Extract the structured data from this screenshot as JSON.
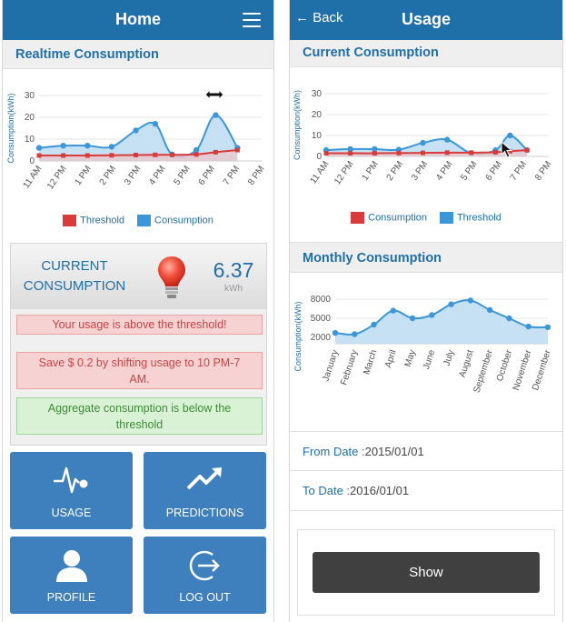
{
  "home": {
    "title": "Home",
    "menu_icon": "hamburger-menu-icon",
    "realtime_header": "Realtime Consumption",
    "chart_legend": {
      "threshold": "Threshold",
      "consumption": "Consumption"
    },
    "current": {
      "label_line1": "CURRENT",
      "label_line2": "CONSUMPTION",
      "value": "6.37",
      "unit": "kWh",
      "bulb_icon": "light-bulb-icon"
    },
    "alerts": {
      "above_threshold": "Your usage is above the threshold!",
      "savings_line1": "Save $ 0.2 by shifting usage to 10 PM-7",
      "savings_line2": "AM.",
      "aggregate_line1": "Aggregate consumption is below the",
      "aggregate_line2": "threshold"
    },
    "tiles": [
      {
        "label": "USAGE",
        "icon": "pulse-icon"
      },
      {
        "label": "PREDICTIONS",
        "icon": "trending-up-icon"
      },
      {
        "label": "PROFILE",
        "icon": "user-icon"
      },
      {
        "label": "LOG OUT",
        "icon": "logout-icon"
      }
    ]
  },
  "usage": {
    "title": "Usage",
    "back_label": "Back",
    "current_header": "Current Consumption",
    "current_legend": {
      "first": "Consumption",
      "second": "Threshold"
    },
    "monthly_header": "Monthly Consumption",
    "from_label": "From Date :",
    "from_value": "2015/01/01",
    "to_label": "To Date :",
    "to_value": "2016/01/01",
    "show_label": "Show"
  },
  "colors": {
    "header_blue": "#1f6fa8",
    "consumption_blue": "#3b97d8",
    "area_fill": "#bcdcf2",
    "threshold_red": "#d93a3a",
    "tile_blue": "#3e7fbe"
  },
  "chart_data": [
    {
      "type": "area",
      "title": "Realtime Consumption",
      "ylabel": "Consumption(kWh)",
      "categories": [
        "11 AM",
        "12 PM",
        "1 PM",
        "2 PM",
        "3 PM",
        "4 PM",
        "5 PM",
        "6 PM",
        "7 PM",
        "8 PM"
      ],
      "yticks": [
        0,
        10,
        20,
        30
      ],
      "ylim": [
        0,
        30
      ],
      "x": [
        0,
        1,
        2,
        3,
        4,
        4.8,
        5.5,
        6.5,
        7.3,
        8.2
      ],
      "series": [
        {
          "name": "Threshold",
          "color": "#d93a3a",
          "values": [
            2.5,
            2.5,
            2.5,
            2.6,
            2.7,
            2.8,
            2.8,
            3.0,
            4.0,
            5.0
          ]
        },
        {
          "name": "Consumption",
          "color": "#3b97d8",
          "values": [
            6,
            7,
            7,
            6.5,
            14,
            17,
            3,
            5,
            21,
            6
          ]
        }
      ],
      "legend": "bottom"
    },
    {
      "type": "area",
      "title": "Current Consumption",
      "ylabel": "Consumption(kWh)",
      "categories": [
        "11 AM",
        "12 PM",
        "1 PM",
        "2 PM",
        "3 PM",
        "4 PM",
        "5 PM",
        "6 PM",
        "7 PM",
        "8 PM"
      ],
      "yticks": [
        0,
        10,
        20,
        30
      ],
      "ylim": [
        0,
        30
      ],
      "x": [
        0,
        1,
        2,
        3,
        4,
        5,
        6,
        7,
        7.6,
        8.3
      ],
      "series": [
        {
          "name": "Consumption",
          "color": "#d93a3a",
          "values": [
            1.5,
            1.5,
            1.5,
            1.6,
            1.7,
            1.8,
            1.8,
            2.0,
            2.5,
            3.0
          ]
        },
        {
          "name": "Threshold",
          "color": "#3b97d8",
          "values": [
            3,
            3.5,
            3.5,
            3.2,
            6.5,
            8,
            1.5,
            3,
            10,
            3
          ]
        }
      ],
      "legend": "bottom"
    },
    {
      "type": "area",
      "title": "Monthly Consumption",
      "ylabel": "Consumption(kWh)",
      "categories": [
        "January",
        "February",
        "March",
        "April",
        "May",
        "June",
        "July",
        "August",
        "September",
        "October",
        "November",
        "December"
      ],
      "yticks": [
        2000,
        5000,
        8000
      ],
      "ylim": [
        1000,
        9000
      ],
      "series": [
        {
          "name": "Consumption",
          "color": "#3b97d8",
          "values": [
            2700,
            2500,
            4000,
            6200,
            5000,
            5500,
            7200,
            7800,
            6300,
            5000,
            3700,
            3600
          ]
        }
      ]
    }
  ]
}
